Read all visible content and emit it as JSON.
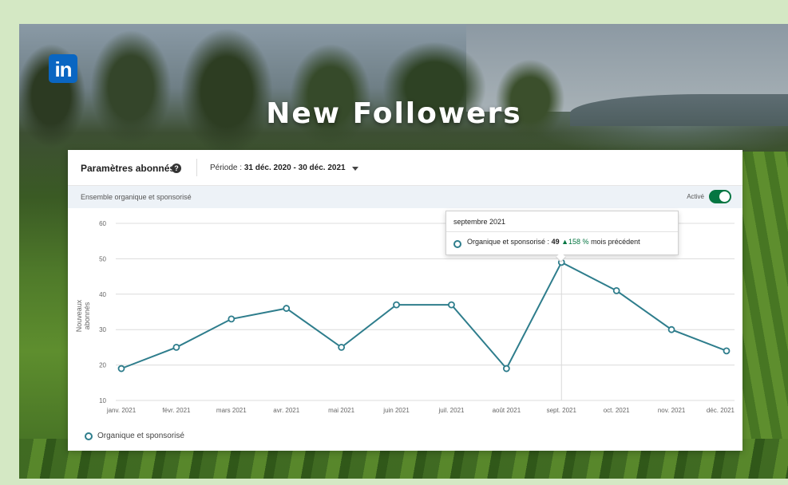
{
  "page": {
    "title": "New Followers",
    "logo_text": "in"
  },
  "colors": {
    "series": "#2e7d8c",
    "toggle": "#057642",
    "positive": "#057642",
    "logo": "#0a66c2"
  },
  "panel": {
    "title": "Paramètres abonnés",
    "help_icon": "?",
    "period_label": "Période :",
    "period_value": "31 déc. 2020 - 30 déc. 2021",
    "subbar_label": "Ensemble organique et sponsorisé",
    "toggle_label": "Activé"
  },
  "tooltip": {
    "title": "septembre 2021",
    "series_label": "Organique et sponsorisé :",
    "value": "49",
    "change": "▲158 %",
    "change_suffix": "mois précédent"
  },
  "chart_data": {
    "type": "line",
    "ylabel": "Nouveaux abonnés",
    "xlabel": "",
    "ylim": [
      10,
      60
    ],
    "y_ticks": [
      60,
      50,
      40,
      30,
      20,
      10
    ],
    "categories": [
      "janv. 2021",
      "févr. 2021",
      "mars 2021",
      "avr. 2021",
      "mai 2021",
      "juin 2021",
      "juil. 2021",
      "août 2021",
      "sept. 2021",
      "oct. 2021",
      "nov. 2021",
      "déc. 2021"
    ],
    "series": [
      {
        "name": "Organique et sponsorisé",
        "values": [
          19,
          25,
          33,
          36,
          25,
          37,
          37,
          19,
          49,
          41,
          30,
          24
        ]
      }
    ],
    "highlighted_index": 8,
    "grid": true,
    "legend": "bottom-left"
  }
}
